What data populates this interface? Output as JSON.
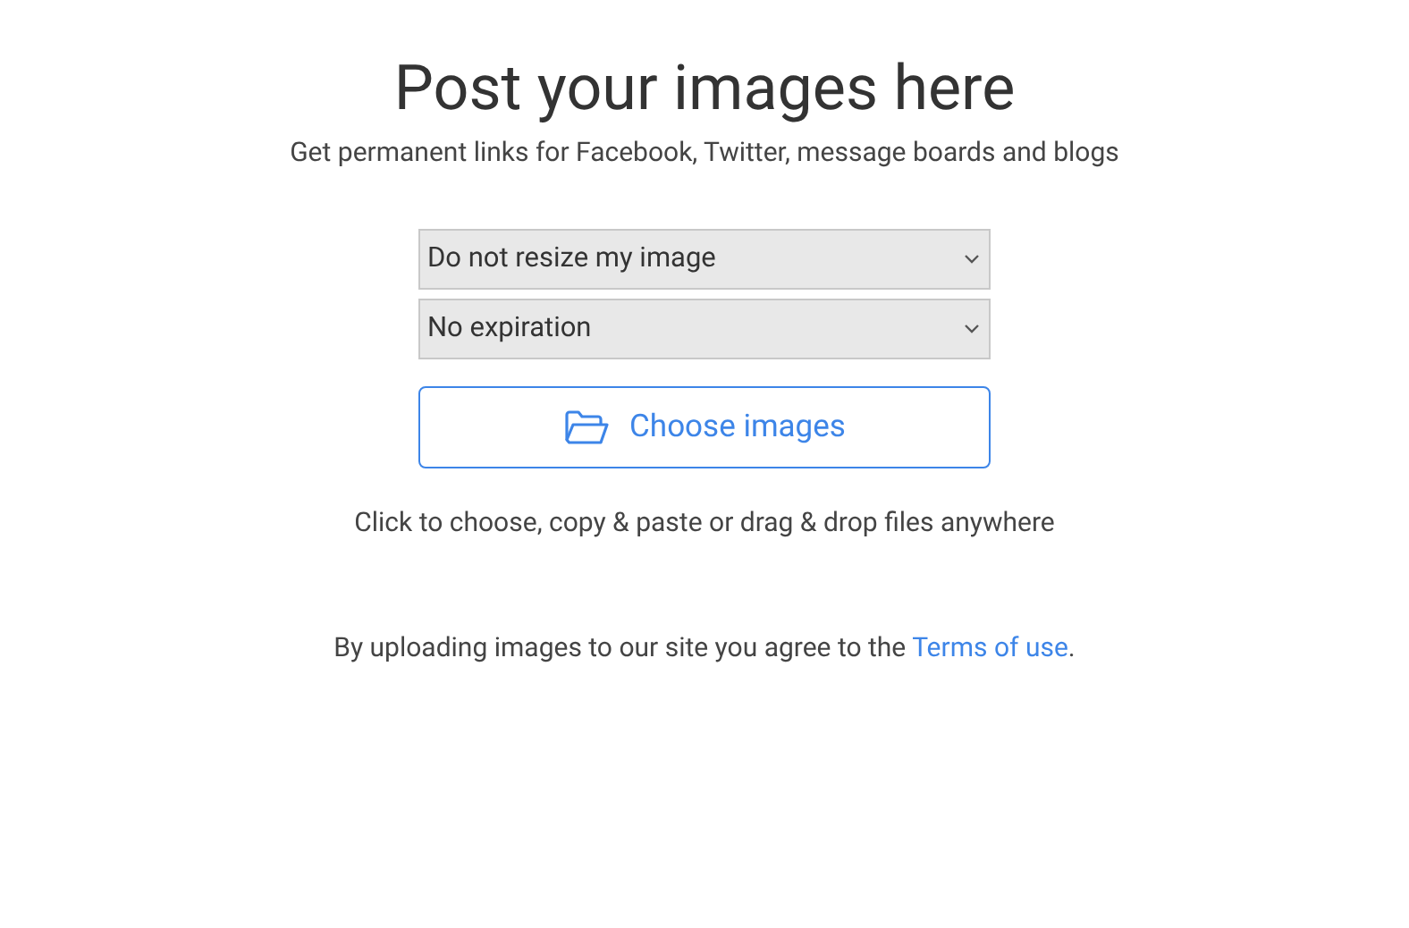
{
  "title": "Post your images here",
  "subtitle": "Get permanent links for Facebook, Twitter, message boards and blogs",
  "selects": [
    {
      "value": "Do not resize my image"
    },
    {
      "value": "No expiration"
    }
  ],
  "choose_button": {
    "label": "Choose images"
  },
  "hint": "Click to choose, copy & paste or drag & drop files anywhere",
  "terms": {
    "before": "By uploading images to our site you agree to the ",
    "link": "Terms of use",
    "after": "."
  }
}
